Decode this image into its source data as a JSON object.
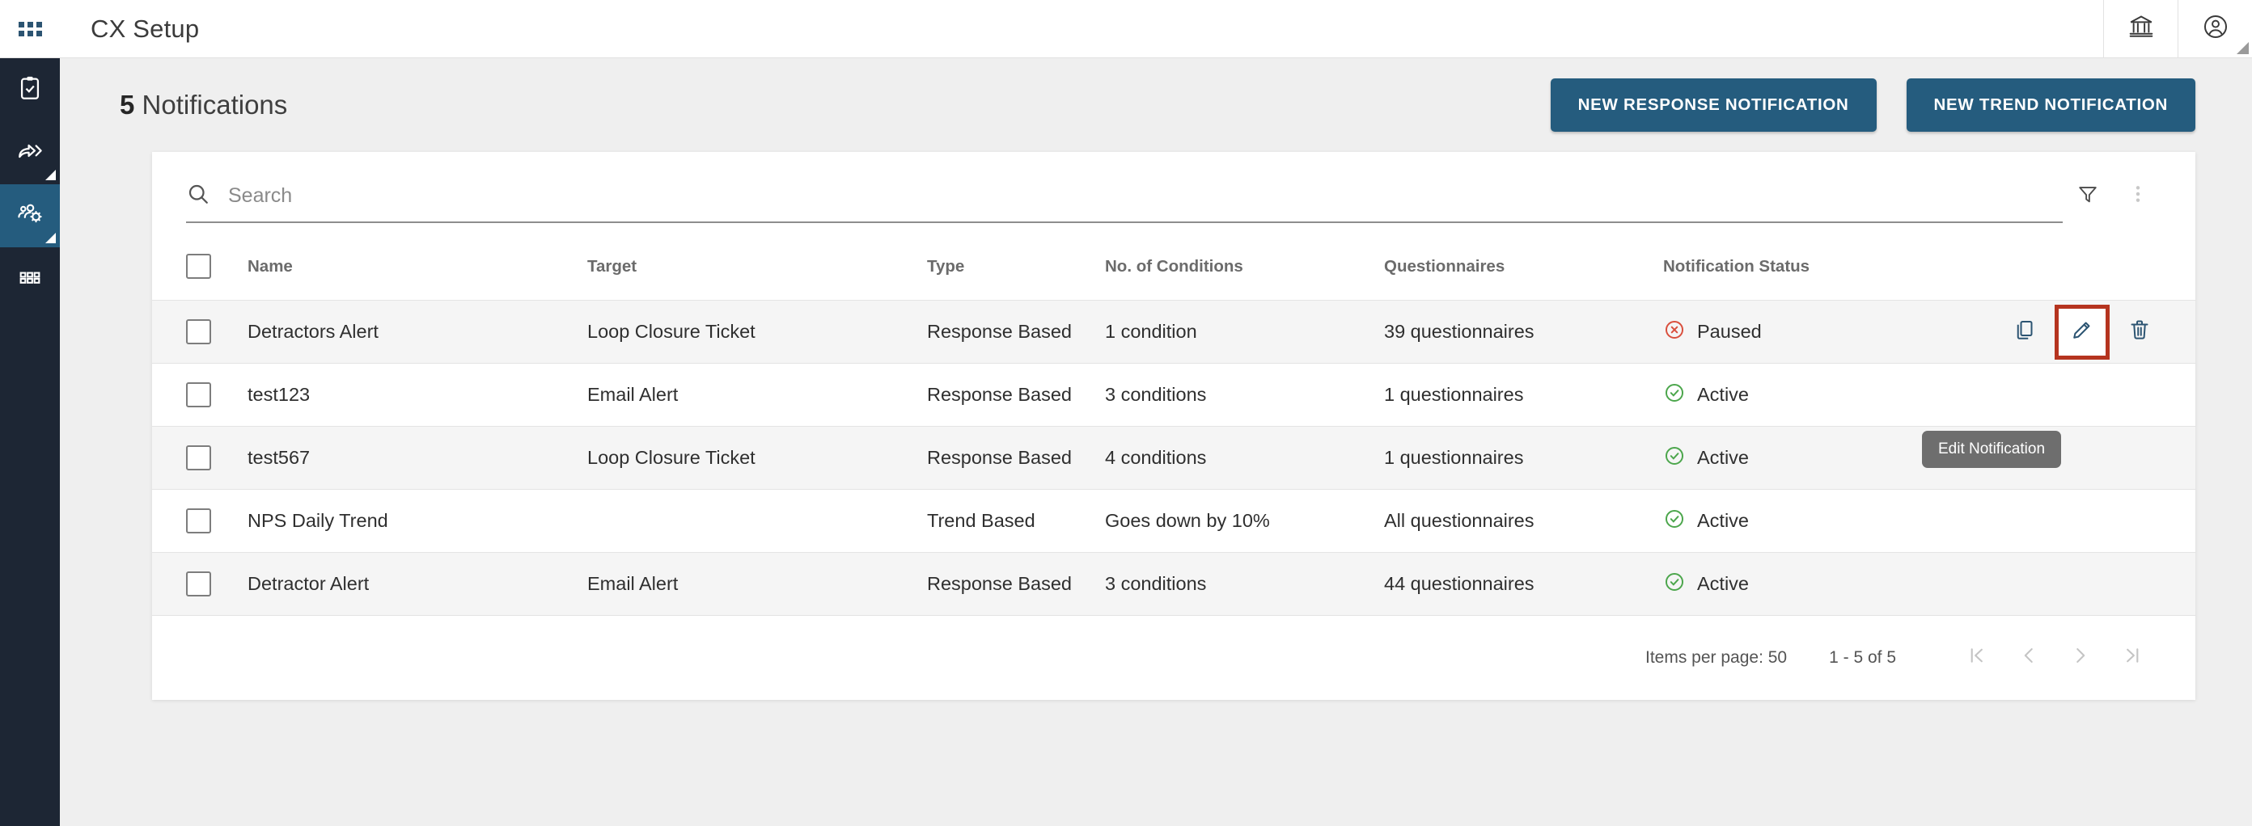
{
  "rail": {
    "apps_icon": "apps-grid-icon",
    "items": [
      {
        "icon": "clipboard-check-icon",
        "active": false,
        "expandable": false
      },
      {
        "icon": "share-forward-icon",
        "active": false,
        "expandable": true
      },
      {
        "icon": "user-settings-icon",
        "active": true,
        "expandable": true
      },
      {
        "icon": "grid-apps-icon",
        "active": false,
        "expandable": false
      }
    ],
    "active_color": "#255c7e",
    "background": "#1d2634"
  },
  "topbar": {
    "title": "CX Setup",
    "bank_icon": "bank-icon",
    "account_icon": "account-circle-icon"
  },
  "page": {
    "count": "5",
    "title_suffix": " Notifications",
    "new_response_label": "NEW RESPONSE NOTIFICATION",
    "new_trend_label": "NEW TREND NOTIFICATION",
    "primary_color": "#255c7e"
  },
  "search": {
    "placeholder": "Search",
    "value": "",
    "search_icon": "search-icon",
    "filter_icon": "filter-icon",
    "more_icon": "more-vertical-icon"
  },
  "table": {
    "columns": [
      "Name",
      "Target",
      "Type",
      "No. of Conditions",
      "Questionnaires",
      "Notification Status"
    ],
    "rows": [
      {
        "name": "Detractors Alert",
        "target": "Loop Closure Ticket",
        "type": "Response Based",
        "conditions": "1 condition",
        "questionnaires": "39 questionnaires",
        "status": "Paused",
        "status_state": "paused"
      },
      {
        "name": "test123",
        "target": "Email Alert",
        "type": "Response Based",
        "conditions": "3 conditions",
        "questionnaires": "1 questionnaires",
        "status": "Active",
        "status_state": "active"
      },
      {
        "name": "test567",
        "target": "Loop Closure Ticket",
        "type": "Response Based",
        "conditions": "4 conditions",
        "questionnaires": "1 questionnaires",
        "status": "Active",
        "status_state": "active"
      },
      {
        "name": "NPS Daily Trend",
        "target": "",
        "type": "Trend Based",
        "conditions": "Goes down by 10%",
        "questionnaires": "All questionnaires",
        "status": "Active",
        "status_state": "active"
      },
      {
        "name": "Detractor Alert",
        "target": "Email Alert",
        "type": "Response Based",
        "conditions": "3 conditions",
        "questionnaires": "44 questionnaires",
        "status": "Active",
        "status_state": "active"
      }
    ],
    "row_actions": {
      "copy_icon": "copy-icon",
      "edit_icon": "edit-pencil-icon",
      "delete_icon": "delete-trash-icon"
    },
    "status_colors": {
      "active": "#4ca64c",
      "paused": "#d94f3d"
    },
    "highlight_color": "#b5341f"
  },
  "tooltip": {
    "text": "Edit Notification"
  },
  "pagination": {
    "items_per_page_label": "Items per page:",
    "items_per_page_value": "50",
    "range": "1 - 5 of 5",
    "first_icon": "first-page-icon",
    "prev_icon": "prev-page-icon",
    "next_icon": "next-page-icon",
    "last_icon": "last-page-icon"
  }
}
